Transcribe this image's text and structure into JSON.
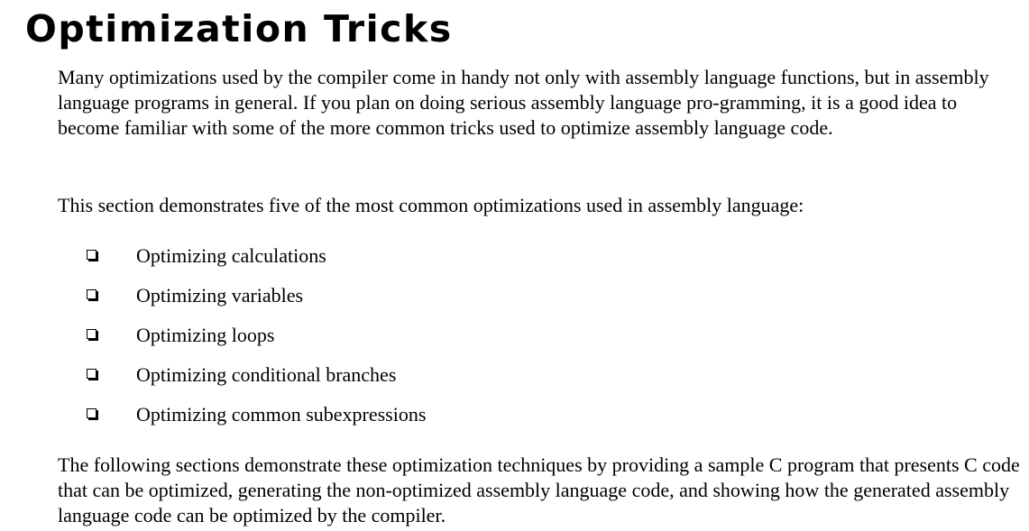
{
  "heading": "Optimization Tricks",
  "paragraphs": [
    "Many optimizations used by the compiler come in handy not only with assembly language functions, but in assembly language programs in general. If you plan on doing serious assembly language pro-gramming, it is a good idea to become familiar with some of the more common tricks used to optimize assembly language code.",
    "This section demonstrates five of the most common optimizations used in assembly language:",
    "The following sections demonstrate these optimization techniques by providing a sample C program that presents C code that can be optimized, generating the non-optimized assembly language code, and showing how the generated assembly language code can be optimized by the compiler."
  ],
  "bullets": [
    "Optimizing calculations",
    "Optimizing variables",
    "Optimizing loops",
    "Optimizing conditional branches",
    "Optimizing common subexpressions"
  ],
  "icons": {
    "bullet": "checkbox-icon"
  }
}
